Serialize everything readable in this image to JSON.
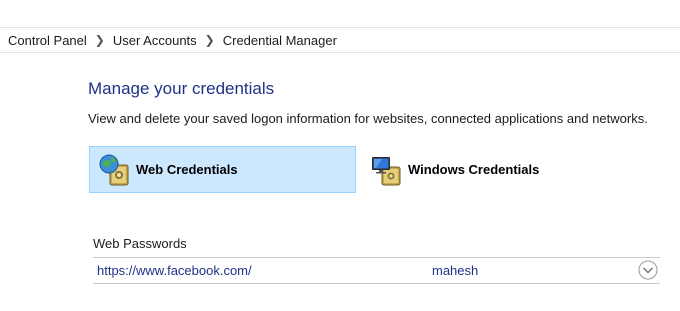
{
  "breadcrumb": {
    "items": [
      "Control Panel",
      "User Accounts",
      "Credential Manager"
    ]
  },
  "main": {
    "title": "Manage your credentials",
    "subtitle": "View and delete your saved logon information for websites, connected applications and networks."
  },
  "credential_tabs": [
    {
      "label": "Web Credentials",
      "icon": "web-credentials-icon",
      "selected": true
    },
    {
      "label": "Windows Credentials",
      "icon": "windows-credentials-icon",
      "selected": false
    }
  ],
  "web_passwords": {
    "heading": "Web Passwords",
    "entries": [
      {
        "site": "https://www.facebook.com/",
        "user": "mahesh",
        "icon": "chevron-down-circle-icon"
      }
    ]
  },
  "colors": {
    "title": "#1e3287",
    "selected_tile_bg": "#cce8ff",
    "selected_tile_border": "#99d1ff",
    "link_text": "#1e3287"
  }
}
